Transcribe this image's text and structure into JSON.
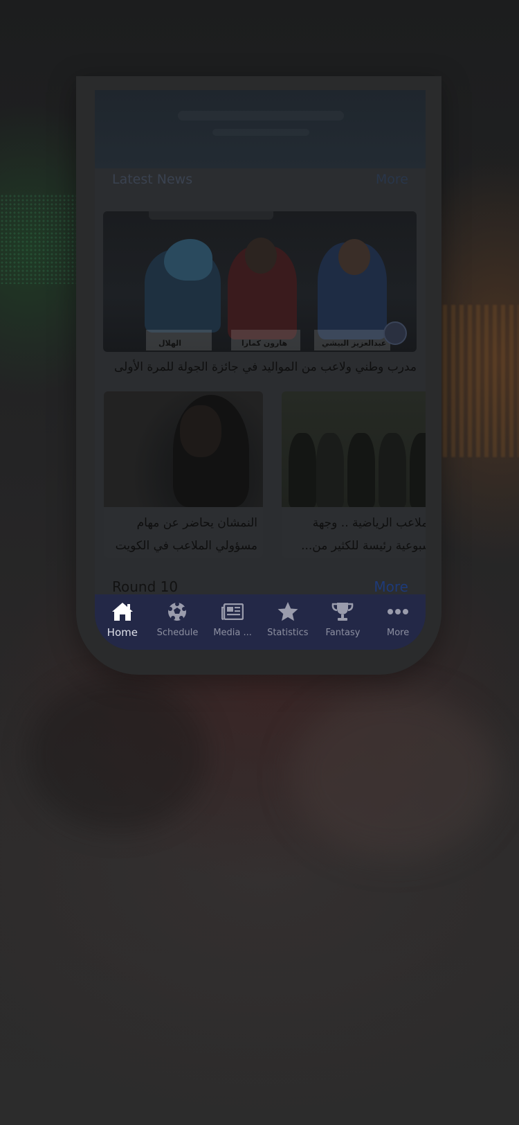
{
  "news": {
    "title": "Latest News",
    "more": "More",
    "hero_headline": "مدرب وطني ولاعب من المواليد في جائزة الجولة للمرة الأولى",
    "hero_names": [
      "الهلال",
      "هارون كمارا",
      "عبدالعزيز البيشي"
    ],
    "cards": [
      {
        "line1": "النمشان يحاضر عن مهام",
        "line2": "مسؤولي الملاعب في الكويت"
      },
      {
        "line1": "الملاعب الرياضية .. وجهة",
        "line2": "أسبوعية رئيسة للكثير من..."
      }
    ]
  },
  "round": {
    "title": "Round 10",
    "more": "More"
  },
  "tabbar": {
    "items": [
      {
        "label": "Home",
        "icon": "home-icon",
        "active": true
      },
      {
        "label": "Schedule",
        "icon": "soccer-ball-icon",
        "active": false
      },
      {
        "label": "Media ...",
        "icon": "newspaper-icon",
        "active": false
      },
      {
        "label": "Statistics",
        "icon": "star-icon",
        "active": false
      },
      {
        "label": "Fantasy",
        "icon": "trophy-icon",
        "active": false
      },
      {
        "label": "More",
        "icon": "ellipsis-icon",
        "active": false
      }
    ]
  },
  "colors": {
    "tabbar_bg": "#232847",
    "tab_active": "#dfe1ea",
    "tab_inactive": "#8c8fa0",
    "more_link": "#1e3a78"
  }
}
